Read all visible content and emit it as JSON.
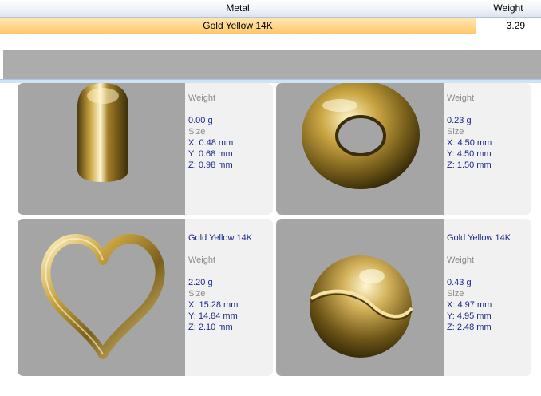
{
  "table": {
    "headers": {
      "metal": "Metal",
      "weight": "Weight"
    },
    "selected_row": {
      "metal": "Gold Yellow 14K",
      "weight": "3.29"
    }
  },
  "labels": {
    "weight": "Weight",
    "size": "Size"
  },
  "items": [
    {
      "name": "",
      "weight": "0.00 g",
      "x": "X: 0.48 mm",
      "y": "Y: 0.68 mm",
      "z": "Z: 0.98 mm",
      "shape": "cylinder-peg"
    },
    {
      "name": "",
      "weight": "0.23 g",
      "x": "X: 4.50 mm",
      "y": "Y: 4.50 mm",
      "z": "Z: 1.50 mm",
      "shape": "donut-bead"
    },
    {
      "name": "Gold Yellow 14K",
      "weight": "2.20 g",
      "x": "X: 15.28 mm",
      "y": "Y: 14.84 mm",
      "z": "Z: 2.10 mm",
      "shape": "heart-pendant"
    },
    {
      "name": "Gold Yellow 14K",
      "weight": "0.43 g",
      "x": "X: 4.97 mm",
      "y": "Y: 4.95 mm",
      "z": "Z: 2.48 mm",
      "shape": "ball-bead"
    }
  ],
  "colors": {
    "gold": "#c9a441",
    "selected_row": "#ffc86a",
    "text_blue": "#1c2a8a"
  }
}
